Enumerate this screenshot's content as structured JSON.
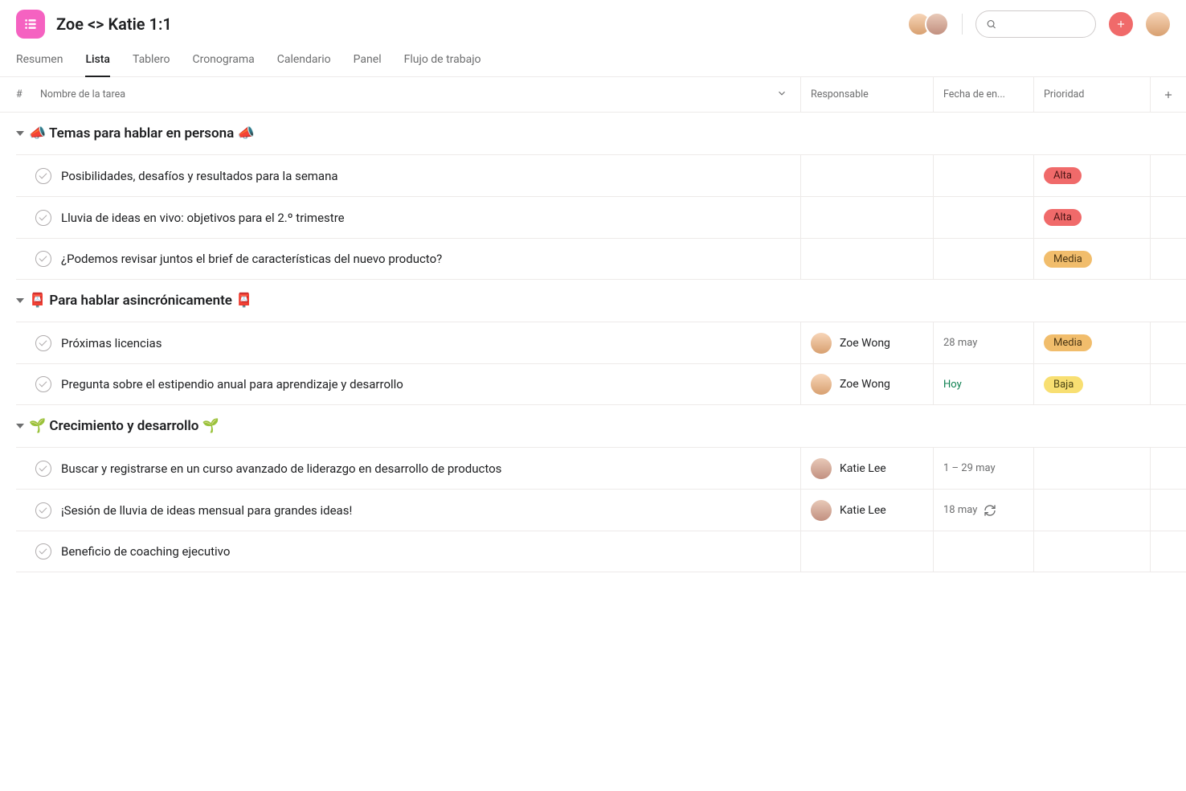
{
  "header": {
    "title": "Zoe <> Katie 1:1"
  },
  "tabs": [
    {
      "label": "Resumen",
      "active": false
    },
    {
      "label": "Lista",
      "active": true
    },
    {
      "label": "Tablero",
      "active": false
    },
    {
      "label": "Cronograma",
      "active": false
    },
    {
      "label": "Calendario",
      "active": false
    },
    {
      "label": "Panel",
      "active": false
    },
    {
      "label": "Flujo de trabajo",
      "active": false
    }
  ],
  "columns": {
    "num": "#",
    "name": "Nombre de la tarea",
    "assignee": "Responsable",
    "due": "Fecha de en...",
    "priority": "Prioridad"
  },
  "priority_labels": {
    "alta": "Alta",
    "media": "Media",
    "baja": "Baja"
  },
  "people": {
    "zoe": "Zoe Wong",
    "katie": "Katie Lee"
  },
  "sections": [
    {
      "title": "📣 Temas para hablar en persona 📣",
      "rows": [
        {
          "name": "Posibilidades, desafíos y resultados para la semana",
          "assignee": null,
          "due": null,
          "priority": "alta"
        },
        {
          "name": "Lluvia de ideas en vivo: objetivos para el 2.º trimestre",
          "assignee": null,
          "due": null,
          "priority": "alta"
        },
        {
          "name": "¿Podemos revisar juntos el brief de características del nuevo producto?",
          "assignee": null,
          "due": null,
          "priority": "media"
        }
      ]
    },
    {
      "title": "📮 Para hablar asincrónicamente 📮",
      "rows": [
        {
          "name": "Próximas licencias",
          "assignee": "zoe",
          "due": "28 may",
          "priority": "media"
        },
        {
          "name": "Pregunta sobre el estipendio anual para aprendizaje y desarrollo",
          "assignee": "zoe",
          "due": "Hoy",
          "due_today": true,
          "priority": "baja"
        }
      ]
    },
    {
      "title": "🌱 Crecimiento y desarrollo 🌱",
      "rows": [
        {
          "name": "Buscar y registrarse en un curso avanzado de liderazgo en desarrollo de productos",
          "assignee": "katie",
          "due": "1 – 29 may",
          "priority": null
        },
        {
          "name": "¡Sesión de lluvia de ideas mensual para grandes ideas!",
          "assignee": "katie",
          "due": "18 may",
          "recurring": true,
          "priority": null
        },
        {
          "name": "Beneficio de coaching ejecutivo",
          "assignee": null,
          "due": null,
          "priority": null
        }
      ]
    }
  ]
}
